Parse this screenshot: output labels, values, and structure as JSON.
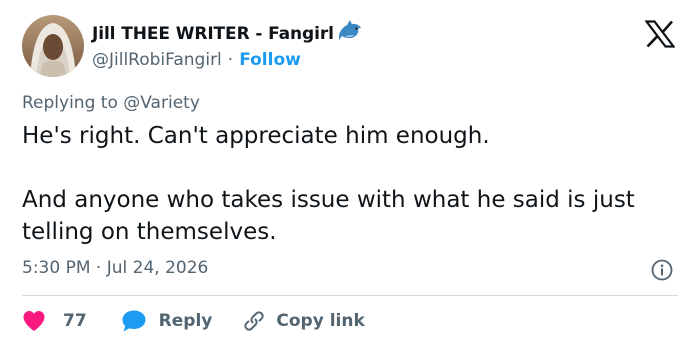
{
  "author": {
    "display_name": "Jill THEE WRITER - Fangirl",
    "handle": "@JillRobiFangirl",
    "separator": "·",
    "follow_label": "Follow"
  },
  "tweet": {
    "replying_prefix": "Replying to",
    "replying_handle": "@Variety",
    "paragraphs": [
      "He's right. Can't appreciate him enough.",
      "And anyone who takes issue with what he said is just telling on themselves."
    ],
    "time": "5:30 PM",
    "date_separator": "·",
    "date": "Jul 24, 2026"
  },
  "actions": {
    "like_count": "77",
    "reply_label": "Reply",
    "copy_link_label": "Copy link"
  },
  "icons": {
    "avatar": "avatar-photo",
    "emoji": "dolphin-icon",
    "logo": "x-logo-icon",
    "info": "info-icon",
    "like": "heart-icon",
    "reply": "speech-bubble-icon",
    "copy": "link-icon"
  },
  "colors": {
    "accent": "#1d9bf0",
    "like": "#f91880",
    "text": "#0f1419",
    "secondary": "#536471",
    "divider": "#cfd9de"
  }
}
